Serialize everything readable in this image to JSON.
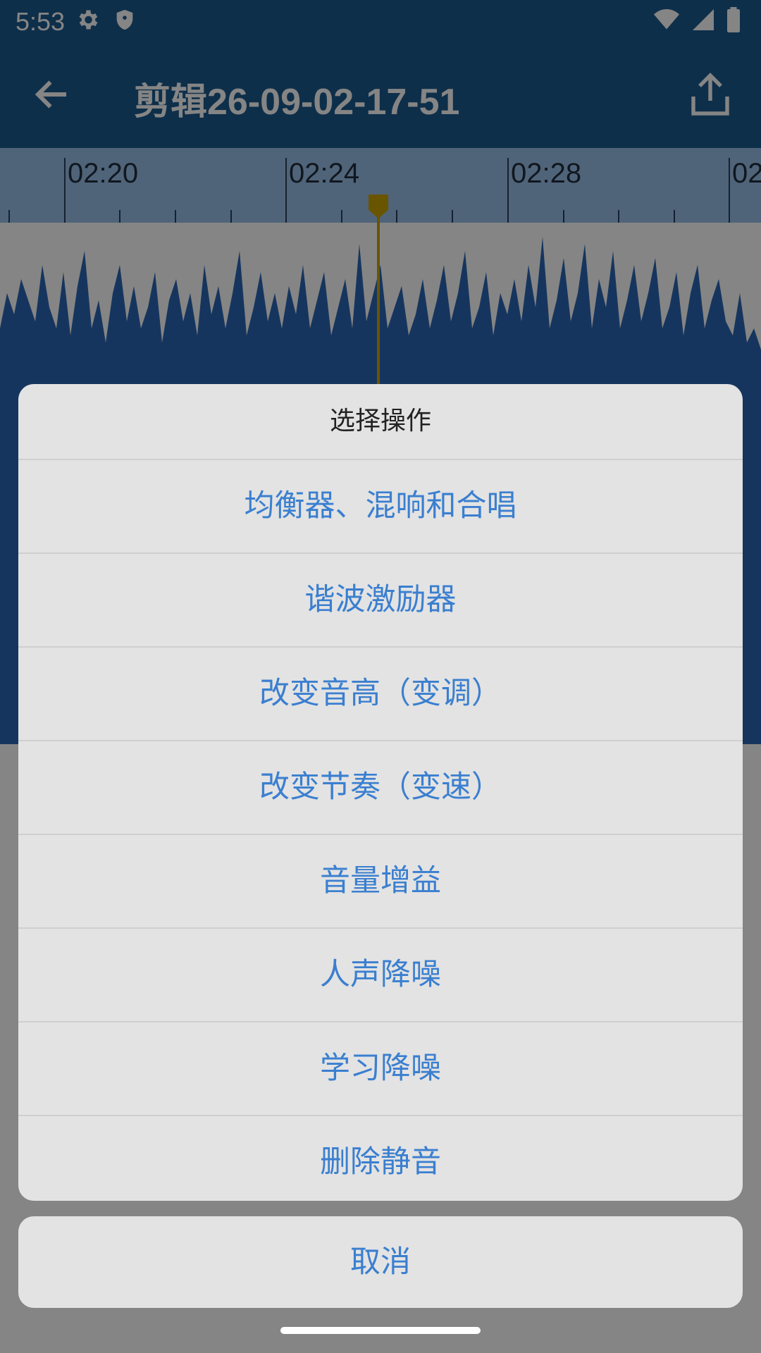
{
  "status_bar": {
    "time": "5:53",
    "left_icons": [
      "gear-icon",
      "shield-icon"
    ],
    "right_icons": [
      "wifi-icon",
      "signal-icon",
      "battery-icon"
    ]
  },
  "toolbar": {
    "title": "剪辑26-09-02-17-51",
    "back_icon": "arrow-back-icon",
    "share_icon": "share-icon"
  },
  "timeline": {
    "labels": [
      "02:20",
      "02:24",
      "02:28",
      "02"
    ],
    "playhead_icon": "playhead-marker-icon"
  },
  "dialog": {
    "title": "选择操作",
    "items": [
      "均衡器、混响和合唱",
      "谐波激励器",
      "改变音高（变调）",
      "改变节奏（变速）",
      "音量增益",
      "人声降噪",
      "学习降噪",
      "删除静音"
    ],
    "cancel": "取消"
  },
  "colors": {
    "toolbar": "#1c5a8e",
    "ruler": "#9ac0e8",
    "waveform": "#2b66b4",
    "playhead": "#c9a400",
    "dialog_bg": "#e3e3e3",
    "dialog_text": "#3a7fd0"
  }
}
